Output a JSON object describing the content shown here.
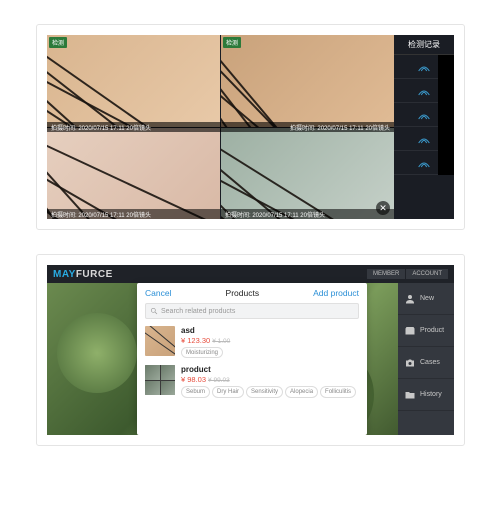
{
  "card1": {
    "sidebar_title": "检测记录",
    "tag_label": "检测",
    "caption_left": "拍摄时间: 2020/07/15  17:11  20倍镜头",
    "caption_right": "拍摄时间: 2020/07/15  17:11  20倍镜头"
  },
  "card2": {
    "brand_1": "MAY",
    "brand_2": "FURCE",
    "top_right": [
      "MEMBER",
      "ACCOUNT"
    ],
    "right_sidebar": [
      {
        "label": "New"
      },
      {
        "label": "Product"
      },
      {
        "label": "Cases"
      },
      {
        "label": "History"
      }
    ],
    "modal": {
      "cancel": "Cancel",
      "title": "Products",
      "add": "Add product",
      "search_placeholder": "Search related products",
      "products": [
        {
          "name": "asd",
          "price": "¥ 123.30",
          "old_price": "¥ 1.00",
          "tags": [
            "Moisturizing"
          ]
        },
        {
          "name": "product",
          "price": "¥ 98.03",
          "old_price": "¥ 99.03",
          "tags": [
            "Sebum",
            "Dry Hair",
            "Sensitivity",
            "Alopecia",
            "Folliculitis"
          ]
        }
      ]
    }
  }
}
